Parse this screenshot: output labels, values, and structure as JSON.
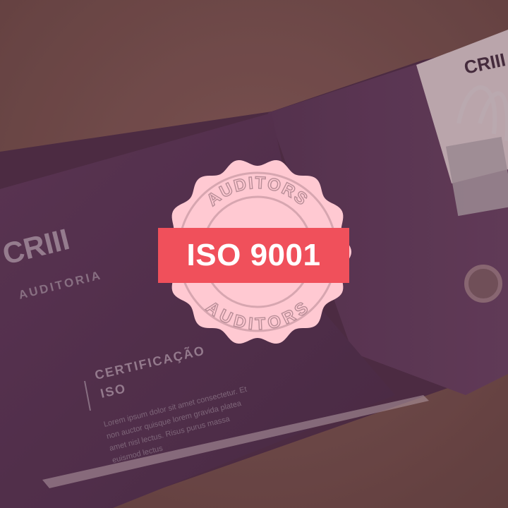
{
  "photo": {
    "brand_mark": "CRIII",
    "brand_name": "AUDITORIA",
    "heading_line1": "CERTIFICAÇÃO",
    "heading_line2": "ISO",
    "body_text": [
      "Lorem ipsum dolor sit amet consectetur. Et",
      "non auctor quisque lorem gravida platea",
      "amet nisl lectus. Risus purus massa",
      "euismod lectus"
    ],
    "folder_color": "#4a2d48",
    "background_color": "#6b4b45",
    "overlay_color": "#7a3f55"
  },
  "seal": {
    "top_text": "AUDITORS",
    "bottom_text": "AUDITORS",
    "badge_text": "ISO 9001",
    "seal_color": "#ffc9d2",
    "ring_color": "#d7a6b0",
    "badge_color": "#f0505b"
  }
}
